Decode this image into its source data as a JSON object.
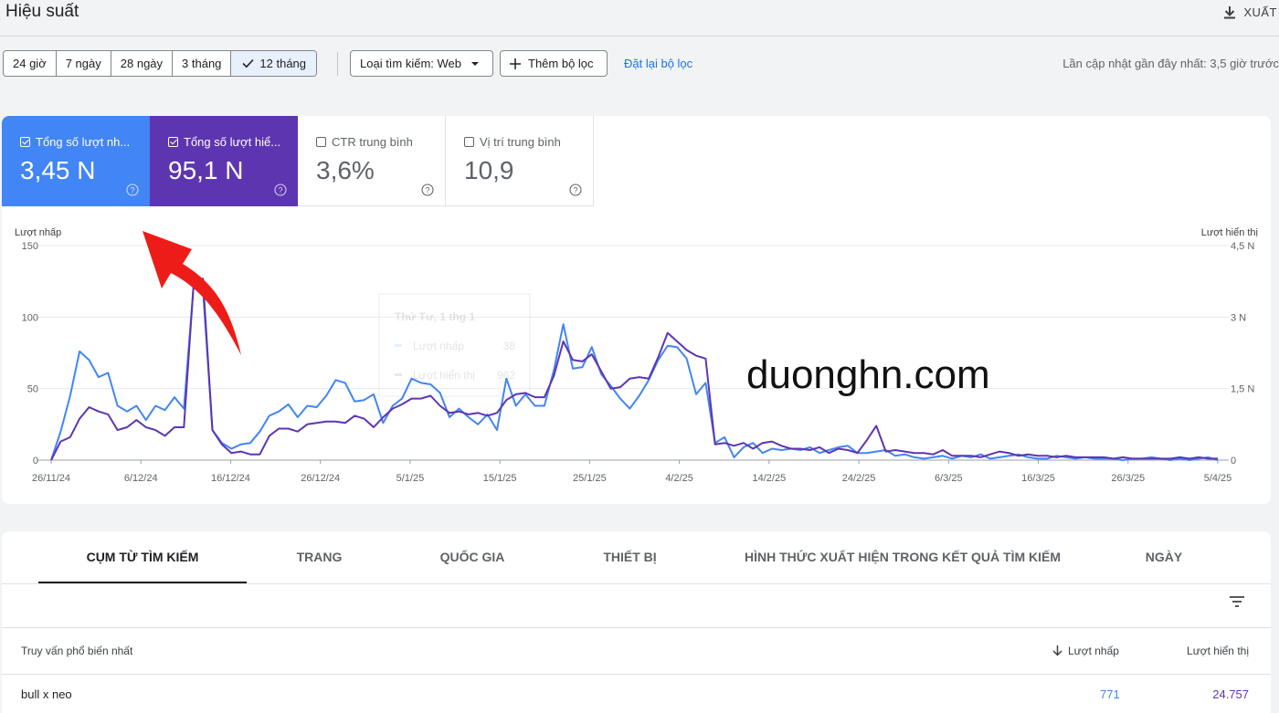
{
  "header": {
    "title": "Hiệu suất",
    "export_label": "XUẤT"
  },
  "filters": {
    "date_ranges": [
      {
        "label": "24 giờ",
        "active": false
      },
      {
        "label": "7 ngày",
        "active": false
      },
      {
        "label": "28 ngày",
        "active": false
      },
      {
        "label": "3 tháng",
        "active": false
      },
      {
        "label": "12 tháng",
        "active": true
      }
    ],
    "search_type": "Loại tìm kiếm: Web",
    "add_filter": "Thêm bộ lọc",
    "reset": "Đặt lại bộ lọc",
    "last_updated": "Lần cập nhật gần đây nhất: 3,5 giờ trước"
  },
  "metrics": [
    {
      "label": "Tổng số lượt nh...",
      "value": "3,45 N",
      "checked": true,
      "color": "#4285f4"
    },
    {
      "label": "Tổng số lượt hiể...",
      "value": "95,1 N",
      "checked": true,
      "color": "#5e35b1"
    },
    {
      "label": "CTR trung bình",
      "value": "3,6%",
      "checked": false
    },
    {
      "label": "Vị trí trung bình",
      "value": "10,9",
      "checked": false
    }
  ],
  "watermark": "duonghn.com",
  "chart_data": {
    "type": "line",
    "left_axis_label": "Lượt nhấp",
    "right_axis_label": "Lượt hiển thị",
    "left_ticks": [
      "150",
      "100",
      "50",
      "0"
    ],
    "right_ticks": [
      "4,5 N",
      "3 N",
      "1,5 N",
      "0"
    ],
    "ylim_left": [
      0,
      150
    ],
    "ylim_right": [
      0,
      4500
    ],
    "x_tick_labels": [
      "26/11/24",
      "6/12/24",
      "16/12/24",
      "26/12/24",
      "5/1/25",
      "15/1/25",
      "25/1/25",
      "4/2/25",
      "14/2/25",
      "24/2/25",
      "6/3/25",
      "16/3/25",
      "26/3/25",
      "5/4/25"
    ],
    "series": [
      {
        "name": "Lượt nhấp",
        "color": "#4285f4",
        "axis": "left",
        "values": [
          0,
          20,
          45,
          76,
          70,
          58,
          61,
          38,
          34,
          38,
          28,
          38,
          35,
          44,
          36,
          120,
          120,
          21,
          12,
          8,
          11,
          12,
          20,
          31,
          34,
          39,
          30,
          38,
          37,
          45,
          56,
          54,
          41,
          42,
          46,
          26,
          38,
          43,
          57,
          54,
          53,
          47,
          30,
          36,
          30,
          25,
          32,
          21,
          57,
          38,
          46,
          38,
          38,
          63,
          95,
          64,
          65,
          79,
          60,
          52,
          43,
          36,
          45,
          56,
          70,
          80,
          79,
          71,
          46,
          54,
          12,
          16,
          2,
          9,
          12,
          5,
          8,
          7,
          8,
          7,
          9,
          5,
          7,
          9,
          10,
          5,
          5,
          6,
          7,
          3,
          4,
          2,
          1,
          2,
          3,
          1,
          3,
          2,
          4,
          1,
          2,
          3,
          4,
          2,
          1,
          1,
          3,
          2,
          1,
          2,
          1,
          1,
          1,
          0,
          1,
          1,
          2,
          1,
          0,
          1,
          0,
          1,
          2,
          0
        ]
      },
      {
        "name": "Lượt hiển thị",
        "color": "#5e35b1",
        "axis": "right",
        "values": [
          0,
          390,
          480,
          870,
          1110,
          1020,
          960,
          630,
          690,
          840,
          690,
          630,
          510,
          690,
          690,
          3630,
          3810,
          630,
          330,
          150,
          180,
          120,
          120,
          510,
          660,
          660,
          600,
          750,
          780,
          810,
          810,
          780,
          930,
          870,
          690,
          900,
          1080,
          1170,
          1290,
          1290,
          1350,
          1140,
          990,
          1020,
          960,
          990,
          930,
          990,
          1260,
          1380,
          1410,
          1320,
          1320,
          1770,
          2490,
          2100,
          2070,
          2220,
          1860,
          1500,
          1530,
          1710,
          1740,
          1710,
          2160,
          2670,
          2490,
          2310,
          2190,
          2130,
          330,
          360,
          300,
          360,
          240,
          360,
          390,
          300,
          240,
          240,
          210,
          270,
          150,
          240,
          210,
          150,
          420,
          720,
          180,
          210,
          180,
          150,
          150,
          120,
          210,
          90,
          90,
          90,
          60,
          120,
          180,
          150,
          90,
          120,
          90,
          90,
          60,
          90,
          60,
          60,
          60,
          60,
          30,
          60,
          30,
          30,
          30,
          30,
          30,
          60,
          30,
          60,
          30,
          30
        ]
      }
    ],
    "tooltip": {
      "date": "Thứ Tư, 1 thg 1",
      "rows": [
        {
          "label": "Lượt nhấp",
          "value": "38"
        },
        {
          "label": "Lượt hiển thị",
          "value": "962"
        }
      ]
    }
  },
  "tabs": [
    "CỤM TỪ TÌM KIẾM",
    "TRANG",
    "QUỐC GIA",
    "THIẾT BỊ",
    "HÌNH THỨC XUẤT HIỆN TRONG KẾT QUẢ TÌM KIẾM",
    "NGÀY"
  ],
  "table": {
    "headers": {
      "query": "Truy vấn phổ biến nhất",
      "clicks": "Lượt nhấp",
      "impressions": "Lượt hiển thị"
    },
    "rows": [
      {
        "query": "bull x neo",
        "clicks": "771",
        "impressions": "24.757"
      }
    ]
  }
}
